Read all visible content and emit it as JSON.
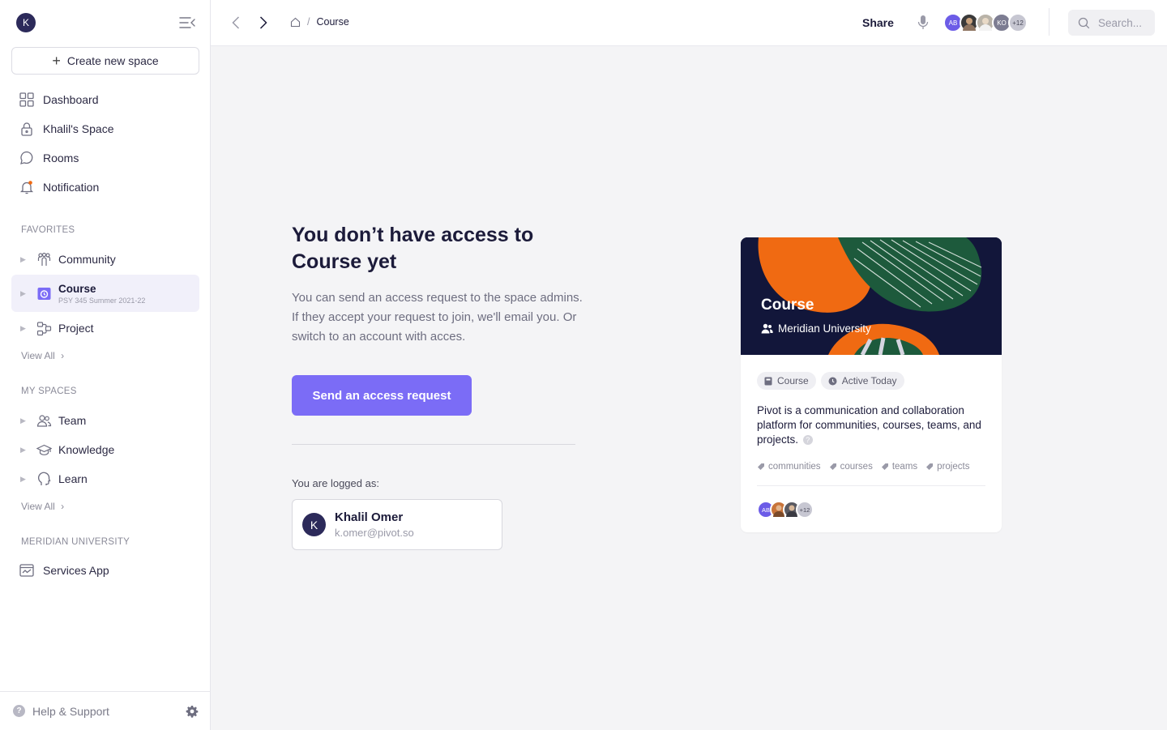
{
  "sidebar": {
    "user_initial": "K",
    "create_label": "Create new space",
    "nav": [
      {
        "label": "Dashboard",
        "icon": "grid-icon"
      },
      {
        "label": "Khalil's Space",
        "icon": "lock-icon"
      },
      {
        "label": "Rooms",
        "icon": "chat-icon"
      },
      {
        "label": "Notification",
        "icon": "bell-icon"
      }
    ],
    "favorites_label": "FAVORITES",
    "favorites": [
      {
        "label": "Community",
        "icon": "community-icon"
      },
      {
        "label": "Course",
        "sub": "PSY 345 Summer 2021-22",
        "icon": "course-icon",
        "active": true
      },
      {
        "label": "Project",
        "icon": "project-icon"
      }
    ],
    "view_all_1": "View All",
    "my_spaces_label": "MY SPACES",
    "my_spaces": [
      {
        "label": "Team",
        "icon": "users-icon"
      },
      {
        "label": "Knowledge",
        "icon": "graduation-cap-icon"
      },
      {
        "label": "Learn",
        "icon": "head-icon"
      }
    ],
    "view_all_2": "View All",
    "org_label": "MERIDIAN UNIVERSITY",
    "org_items": [
      {
        "label": "Services App",
        "icon": "app-icon"
      }
    ],
    "help_label": "Help & Support"
  },
  "topbar": {
    "breadcrumb": "Course",
    "breadcrumb_sep": "/",
    "share_label": "Share",
    "avatars": [
      {
        "initials": "AB",
        "color": "#6c5ce7"
      },
      {
        "initials": "",
        "color": "#3a3a3a"
      },
      {
        "initials": "",
        "color": "#b9b3a8"
      },
      {
        "initials": "KO",
        "color": "#7d7d92"
      },
      {
        "initials": "+12",
        "color": "#c7c7d2"
      }
    ],
    "search_placeholder": "Search..."
  },
  "main": {
    "heading": "You don’t have access to Course yet",
    "description": "You can send an access request to the space admins. If they accept your request to join, we'll email you. Or switch to an account with acces.",
    "request_button": "Send an access request",
    "logged_label": "You are logged as:",
    "account": {
      "initial": "K",
      "name": "Khalil Omer",
      "email": "k.omer@pivot.so"
    }
  },
  "preview_card": {
    "title": "Course",
    "org": "Meridian University",
    "chips": [
      {
        "label": "Course",
        "icon": "book-icon"
      },
      {
        "label": "Active Today",
        "icon": "clock-icon"
      }
    ],
    "description": "Pivot is a communication and collaboration platform for communities, courses, teams, and projects.",
    "tags": [
      "communities",
      "courses",
      "teams",
      "projects"
    ],
    "avatars": [
      {
        "initials": "AB",
        "color": "#6c5ce7"
      },
      {
        "initials": "",
        "color": "#c8743a"
      },
      {
        "initials": "",
        "color": "#5a5a62"
      },
      {
        "initials": "+12",
        "color": "#c7c7d2"
      }
    ]
  },
  "colors": {
    "accent": "#7b6cf6",
    "navy": "#1c1b3a",
    "banner": "#12163a",
    "orange": "#f06a12",
    "green": "#1d5a3c"
  }
}
